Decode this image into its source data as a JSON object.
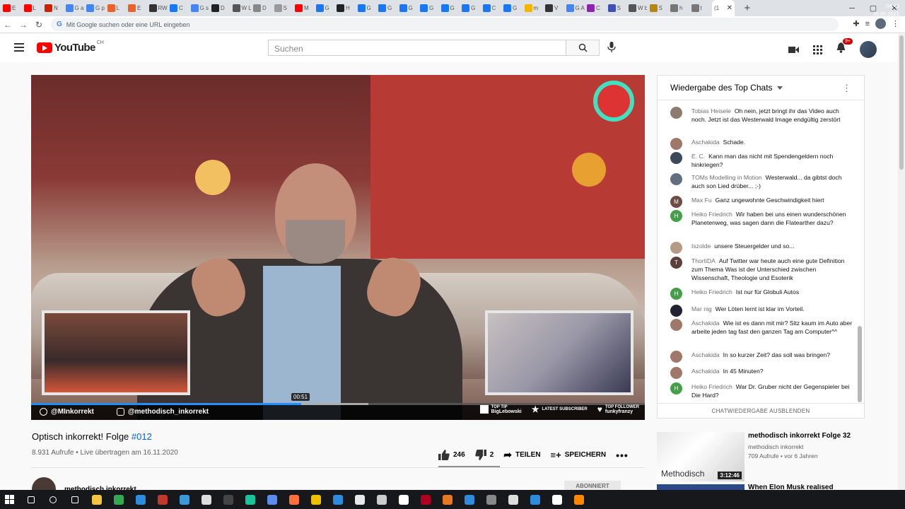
{
  "browser": {
    "tabs": [
      {
        "label": "E",
        "color": "#ff0000"
      },
      {
        "label": "L",
        "color": "#ff0000"
      },
      {
        "label": "N",
        "color": "#cc2200"
      },
      {
        "label": "G a",
        "color": "#4285f4"
      },
      {
        "label": "G p",
        "color": "#4285f4"
      },
      {
        "label": "L",
        "color": "#e8622a"
      },
      {
        "label": "E",
        "color": "#e8622a"
      },
      {
        "label": "RW B",
        "color": "#333333"
      },
      {
        "label": "C",
        "color": "#1877f2"
      },
      {
        "label": "G s",
        "color": "#4285f4"
      },
      {
        "label": "D",
        "color": "#222222"
      },
      {
        "label": "W L",
        "color": "#555555"
      },
      {
        "label": "D",
        "color": "#888888"
      },
      {
        "label": "S",
        "color": "#999999"
      },
      {
        "label": "M",
        "color": "#ff0000"
      },
      {
        "label": "G",
        "color": "#1877f2"
      },
      {
        "label": "H",
        "color": "#222222"
      },
      {
        "label": "G",
        "color": "#1877f2"
      },
      {
        "label": "G",
        "color": "#1877f2"
      },
      {
        "label": "G",
        "color": "#1877f2"
      },
      {
        "label": "G",
        "color": "#1877f2"
      },
      {
        "label": "G",
        "color": "#1877f2"
      },
      {
        "label": "G",
        "color": "#1877f2"
      },
      {
        "label": "C",
        "color": "#1877f2"
      },
      {
        "label": "G",
        "color": "#1877f2"
      },
      {
        "label": "m",
        "color": "#f4b400"
      },
      {
        "label": "V",
        "color": "#333333"
      },
      {
        "label": "G A",
        "color": "#4285f4"
      },
      {
        "label": "C",
        "color": "#8e24aa"
      },
      {
        "label": "S",
        "color": "#3f51b5"
      },
      {
        "label": "W b",
        "color": "#555555"
      },
      {
        "label": "S",
        "color": "#b8860b"
      },
      {
        "label": "h",
        "color": "#777777"
      },
      {
        "label": "t",
        "color": "#777777"
      }
    ],
    "active_tab": {
      "label": "(1",
      "close": "✕"
    },
    "new_tab": "+",
    "address_placeholder": "Mit Google suchen oder eine URL eingeben"
  },
  "youtube": {
    "logo_text": "YouTube",
    "country": "CH",
    "search_placeholder": "Suchen",
    "notification_count": "9+"
  },
  "video": {
    "overlay_twitter": "@MInkorrekt",
    "overlay_instagram": "@methodisch_inkorrekt",
    "overlay_top_tip_label": "TOP TIP",
    "overlay_top_tip_name": "BigLebowski",
    "overlay_sub_label": "LATEST SUBSCRIBER",
    "overlay_follow_label": "TOP FOLLOWER",
    "overlay_follow_name": "funkyfranzy",
    "hover_time": "00:51",
    "progress_fraction": 0.44,
    "title_prefix": "Optisch inkorrekt! Folge ",
    "title_tag": "#012",
    "meta": "8.931 Aufrufe • Live übertragen am 16.11.2020",
    "likes": "246",
    "dislikes": "2",
    "share": "TEILEN",
    "save": "SPEICHERN",
    "channel": "methodisch inkorrekt",
    "subscribe": "ABONNIERT"
  },
  "chat": {
    "header": "Wiedergabe des Top Chats",
    "footer": "CHATWIEDERGABE AUSBLENDEN",
    "messages": [
      {
        "author": "Tobias Heisele",
        "text": "Oh nein, jetzt bringt ihr das Video auch noch. Jetzt ist das Westerwald Image endgültig zerstört",
        "avatar_color": "#8d7b6e",
        "initial": ""
      },
      {
        "author": "Aschakida",
        "text": "Schade.",
        "avatar_color": "#a0786a",
        "initial": ""
      },
      {
        "author": "E. C.",
        "text": "Kann man das nicht mit Spendengeldern noch hinkriegen?",
        "avatar_color": "#3a4a5a",
        "initial": ""
      },
      {
        "author": "TOMs Modelling in Motion",
        "text": "Westerwald... da gibtst doch auch son Lied drüber... ;-)",
        "avatar_color": "#5f6f80",
        "initial": ""
      },
      {
        "author": "Max Fu",
        "text": "Ganz ungewohnte Geschwindigkeit hiert",
        "avatar_color": "#6d4c41",
        "initial": "M"
      },
      {
        "author": "Heiko Friedrich",
        "text": "Wir haben bei uns einen wunderschönen Planetenweg, was sagen dann die Flatearther dazu?",
        "avatar_color": "#43a047",
        "initial": "H"
      },
      {
        "author": "Iszolde",
        "text": "unsere Steuergelder und so...",
        "avatar_color": "#b59a85",
        "initial": ""
      },
      {
        "author": "ThortiDA",
        "text": "Auf Twitter war heute auch eine gute Definition zum Thema Was ist der Unterschied zwischen Wissenschaft, Theologie und Esoterik",
        "avatar_color": "#5d4037",
        "initial": "T"
      },
      {
        "author": "Heiko Friedrich",
        "text": "Ist nur für Globuli Autos",
        "avatar_color": "#43a047",
        "initial": "H"
      },
      {
        "author": "Mar nig",
        "text": "Wer Löten lernt ist klar im Vorteil.",
        "avatar_color": "#222233",
        "initial": ""
      },
      {
        "author": "Aschakida",
        "text": "Wie ist es dann mit mir? Sitz kaum im Auto aber arbeite jeden tag fast den ganzen Tag am Computer^^",
        "avatar_color": "#a0786a",
        "initial": ""
      },
      {
        "author": "Aschakida",
        "text": "In so kurzer Zeit? das soll was bringen?",
        "avatar_color": "#a0786a",
        "initial": ""
      },
      {
        "author": "Aschakida",
        "text": "In 45 Minuten?",
        "avatar_color": "#a0786a",
        "initial": ""
      },
      {
        "author": "Heiko Friedrich",
        "text": "War Dr. Gruber nicht der Gegenspieler bei Die Hard?",
        "avatar_color": "#43a047",
        "initial": "H"
      }
    ]
  },
  "recommendations": [
    {
      "title": "methodisch inkorrekt Folge 32",
      "channel": "methodisch inkorrekt",
      "meta": "709 Aufrufe • vor 6 Jahren",
      "duration": "3:12:46",
      "thumb_text": "Methodisch"
    },
    {
      "title": "When Elon Musk realised",
      "channel": "",
      "meta": "",
      "duration": "",
      "thumb_text": ""
    }
  ],
  "taskbar": {
    "time": "04:40",
    "date": "30.05.2021",
    "icons": [
      {
        "name": "search-icon",
        "color": "#ffffff"
      },
      {
        "name": "cortana-icon",
        "color": "#ffffff"
      },
      {
        "name": "taskview-icon",
        "color": "#ffffff"
      },
      {
        "name": "explorer-icon",
        "color": "#f5c542"
      },
      {
        "name": "chrome-icon",
        "color": "#34a853"
      },
      {
        "name": "edge-icon",
        "color": "#2d8cde"
      },
      {
        "name": "app-icon",
        "color": "#c0392b"
      },
      {
        "name": "app-icon",
        "color": "#3a9ad9"
      },
      {
        "name": "app-icon",
        "color": "#dddddd"
      },
      {
        "name": "app-icon",
        "color": "#444444"
      },
      {
        "name": "app-icon",
        "color": "#19c39c"
      },
      {
        "name": "app-icon",
        "color": "#5b8def"
      },
      {
        "name": "firefox-icon",
        "color": "#ff7139"
      },
      {
        "name": "app-icon",
        "color": "#f0c000"
      },
      {
        "name": "app-icon",
        "color": "#2d8cde"
      },
      {
        "name": "app-icon",
        "color": "#e8e8e8"
      },
      {
        "name": "app-icon",
        "color": "#cccccc"
      },
      {
        "name": "app-icon",
        "color": "#ffffff"
      },
      {
        "name": "app-icon",
        "color": "#b00020"
      },
      {
        "name": "app-icon",
        "color": "#e87722"
      },
      {
        "name": "app-icon",
        "color": "#2d8cde"
      },
      {
        "name": "app-icon",
        "color": "#888888"
      },
      {
        "name": "app-icon",
        "color": "#dddddd"
      },
      {
        "name": "app-icon",
        "color": "#2d8cde"
      },
      {
        "name": "app-icon",
        "color": "#ffffff"
      },
      {
        "name": "vlc-icon",
        "color": "#ff8800"
      }
    ]
  }
}
